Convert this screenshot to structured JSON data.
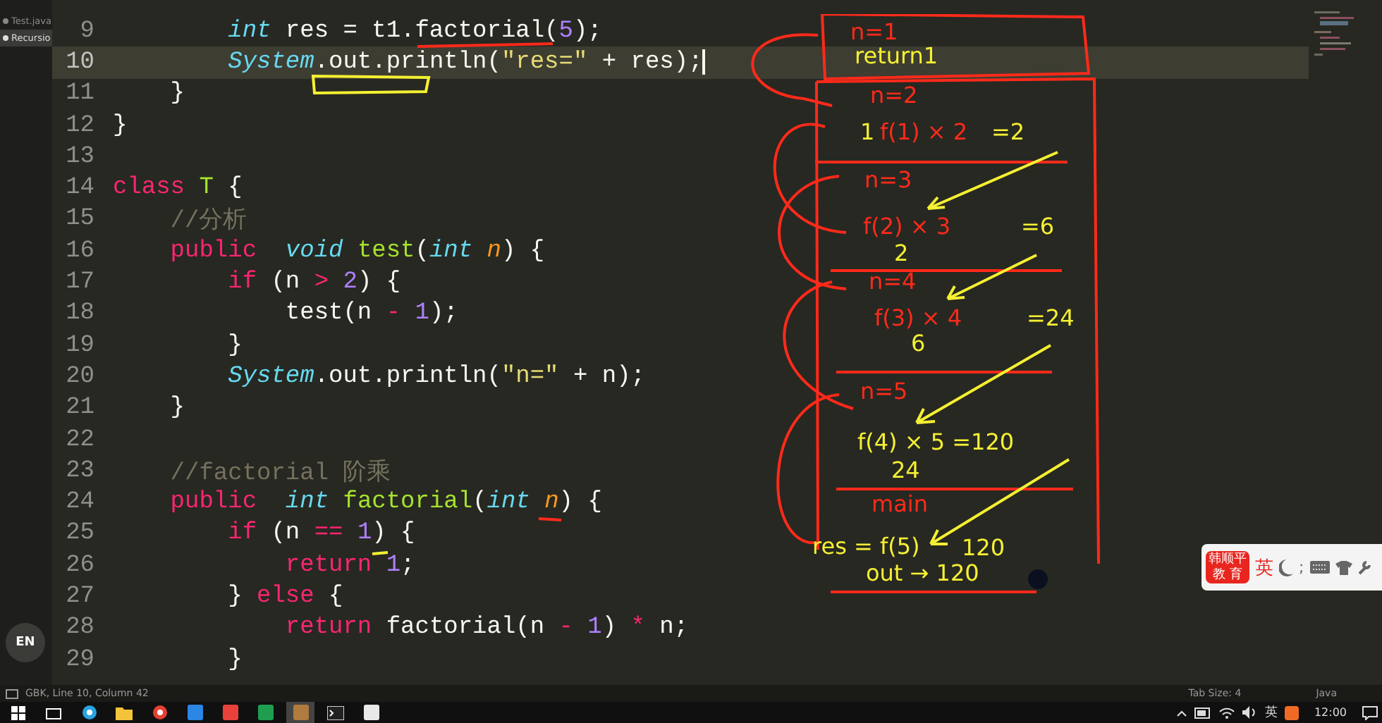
{
  "sidebar": {
    "files": [
      {
        "name": "Test.java",
        "selected": false
      },
      {
        "name": "Recursio",
        "selected": true
      }
    ],
    "language_button": "EN"
  },
  "editor": {
    "lines": [
      {
        "number": "9",
        "current": false,
        "tokens": [
          {
            "kind": "type",
            "text": "        int"
          },
          {
            "kind": "plain",
            "text": " res = t1.factorial("
          },
          {
            "kind": "number",
            "text": "5"
          },
          {
            "kind": "plain",
            "text": ");"
          }
        ]
      },
      {
        "number": "10",
        "current": true,
        "tokens": [
          {
            "kind": "type",
            "text": "        System"
          },
          {
            "kind": "plain",
            "text": ".out.println("
          },
          {
            "kind": "string",
            "text": "\"res=\""
          },
          {
            "kind": "plain",
            "text": " + res);"
          }
        ]
      },
      {
        "number": "11",
        "current": false,
        "tokens": [
          {
            "kind": "plain",
            "text": "    }"
          }
        ]
      },
      {
        "number": "12",
        "current": false,
        "tokens": [
          {
            "kind": "plain",
            "text": "}"
          }
        ]
      },
      {
        "number": "13",
        "current": false
      },
      {
        "number": "14",
        "current": false,
        "tokens": [
          {
            "kind": "keyword",
            "text": "class"
          },
          {
            "kind": "name",
            "text": " T"
          },
          {
            "kind": "plain",
            "text": " {"
          }
        ]
      },
      {
        "number": "15",
        "current": false,
        "tokens": [
          {
            "kind": "comment",
            "text": "    //分析"
          }
        ]
      },
      {
        "number": "16",
        "current": false,
        "tokens": [
          {
            "kind": "keyword",
            "text": "    public"
          },
          {
            "kind": "type",
            "text": "  void"
          },
          {
            "kind": "name",
            "text": " test"
          },
          {
            "kind": "plain",
            "text": "("
          },
          {
            "kind": "type",
            "text": "int"
          },
          {
            "kind": "param",
            "text": " n"
          },
          {
            "kind": "plain",
            "text": ") {"
          }
        ]
      },
      {
        "number": "17",
        "current": false,
        "tokens": [
          {
            "kind": "keyword",
            "text": "        if"
          },
          {
            "kind": "plain",
            "text": " (n "
          },
          {
            "kind": "keyword",
            "text": ">"
          },
          {
            "kind": "number",
            "text": " 2"
          },
          {
            "kind": "plain",
            "text": ") {"
          }
        ]
      },
      {
        "number": "18",
        "current": false,
        "tokens": [
          {
            "kind": "plain",
            "text": "            test(n "
          },
          {
            "kind": "keyword",
            "text": "-"
          },
          {
            "kind": "number",
            "text": " 1"
          },
          {
            "kind": "plain",
            "text": ");"
          }
        ]
      },
      {
        "number": "19",
        "current": false,
        "tokens": [
          {
            "kind": "plain",
            "text": "        }"
          }
        ]
      },
      {
        "number": "20",
        "current": false,
        "tokens": [
          {
            "kind": "type",
            "text": "        System"
          },
          {
            "kind": "plain",
            "text": ".out.println("
          },
          {
            "kind": "string",
            "text": "\"n=\""
          },
          {
            "kind": "plain",
            "text": " + n);"
          }
        ]
      },
      {
        "number": "21",
        "current": false,
        "tokens": [
          {
            "kind": "plain",
            "text": "    }"
          }
        ]
      },
      {
        "number": "22",
        "current": false
      },
      {
        "number": "23",
        "current": false,
        "tokens": [
          {
            "kind": "comment",
            "text": "    //factorial 阶乘"
          }
        ]
      },
      {
        "number": "24",
        "current": false,
        "tokens": [
          {
            "kind": "keyword",
            "text": "    public"
          },
          {
            "kind": "type",
            "text": "  int"
          },
          {
            "kind": "name",
            "text": " factorial"
          },
          {
            "kind": "plain",
            "text": "("
          },
          {
            "kind": "type",
            "text": "int"
          },
          {
            "kind": "param",
            "text": " n"
          },
          {
            "kind": "plain",
            "text": ") {"
          }
        ]
      },
      {
        "number": "25",
        "current": false,
        "tokens": [
          {
            "kind": "keyword",
            "text": "        if"
          },
          {
            "kind": "plain",
            "text": " (n "
          },
          {
            "kind": "keyword",
            "text": "=="
          },
          {
            "kind": "number",
            "text": " 1"
          },
          {
            "kind": "plain",
            "text": ") {"
          }
        ]
      },
      {
        "number": "26",
        "current": false,
        "tokens": [
          {
            "kind": "keyword",
            "text": "            return"
          },
          {
            "kind": "number",
            "text": " 1"
          },
          {
            "kind": "plain",
            "text": ";"
          }
        ]
      },
      {
        "number": "27",
        "current": false,
        "tokens": [
          {
            "kind": "plain",
            "text": "        } "
          },
          {
            "kind": "keyword",
            "text": "else"
          },
          {
            "kind": "plain",
            "text": " {"
          }
        ]
      },
      {
        "number": "28",
        "current": false,
        "tokens": [
          {
            "kind": "keyword",
            "text": "            return"
          },
          {
            "kind": "plain",
            "text": " factorial(n "
          },
          {
            "kind": "keyword",
            "text": "-"
          },
          {
            "kind": "number",
            "text": " 1"
          },
          {
            "kind": "plain",
            "text": ") "
          },
          {
            "kind": "keyword",
            "text": "*"
          },
          {
            "kind": "plain",
            "text": " n;"
          }
        ]
      },
      {
        "number": "29",
        "current": false,
        "tokens": [
          {
            "kind": "plain",
            "text": "        }"
          }
        ]
      }
    ]
  },
  "annotations": [
    {
      "text": "n=1",
      "color": "#ff2a1a"
    },
    {
      "text": "return1",
      "color": "#f5f032"
    },
    {
      "text": "n=2",
      "color": "#ff2a1a"
    },
    {
      "text": "1",
      "color": "#f5f032"
    },
    {
      "text": "f(1) × 2",
      "color": "#ff2a1a"
    },
    {
      "text": "=2",
      "color": "#f5f032"
    },
    {
      "text": "n=3",
      "color": "#ff2a1a"
    },
    {
      "text": "f(2) × 3",
      "color": "#ff2a1a"
    },
    {
      "text": "=6",
      "color": "#f5f032"
    },
    {
      "text": "2",
      "color": "#f5f032"
    },
    {
      "text": "n=4",
      "color": "#ff2a1a"
    },
    {
      "text": "f(3) × 4",
      "color": "#ff2a1a"
    },
    {
      "text": "=24",
      "color": "#f5f032"
    },
    {
      "text": "6",
      "color": "#f5f032"
    },
    {
      "text": "n=5",
      "color": "#ff2a1a"
    },
    {
      "text": "f(4) × 5 =120",
      "color": "#f5f032"
    },
    {
      "text": "24",
      "color": "#f5f032"
    },
    {
      "text": "main",
      "color": "#ff2a1a"
    },
    {
      "text": "res = f(5)",
      "color": "#f5f032"
    },
    {
      "text": "120",
      "color": "#f5f032"
    },
    {
      "text": "out → 120",
      "color": "#f5f032"
    }
  ],
  "ime_toolbar": {
    "badge_top": "韩顺平",
    "badge_bottom": "教 育",
    "mode": "英",
    "separator": ";"
  },
  "status_bar": {
    "position": "GBK, Line 10, Column 42",
    "tab_size": "Tab Size: 4",
    "syntax": "Java"
  },
  "taskbar": {
    "apps": [
      {
        "kind": "start",
        "selected": false
      },
      {
        "kind": "task-view",
        "selected": false
      },
      {
        "kind": "browser",
        "selected": false
      },
      {
        "kind": "folder",
        "selected": false
      },
      {
        "kind": "chrome",
        "selected": false
      },
      {
        "kind": "blue-app",
        "selected": false
      },
      {
        "kind": "red-app",
        "selected": false
      },
      {
        "kind": "green-app",
        "selected": false
      },
      {
        "kind": "editor",
        "selected": true
      },
      {
        "kind": "terminal",
        "selected": false
      },
      {
        "kind": "doc-app",
        "selected": false
      }
    ],
    "input_method": "英",
    "clock": "12:00"
  }
}
